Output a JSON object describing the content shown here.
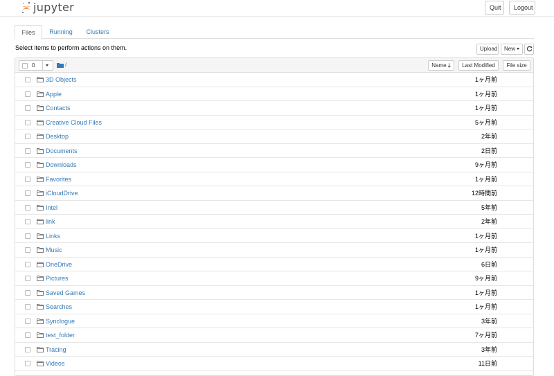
{
  "header": {
    "logo_text": "jupyter",
    "quit_label": "Quit",
    "logout_label": "Logout"
  },
  "tabs": [
    {
      "label": "Files",
      "active": true
    },
    {
      "label": "Running",
      "active": false
    },
    {
      "label": "Clusters",
      "active": false
    }
  ],
  "toolbar": {
    "instructions": "Select items to perform actions on them.",
    "upload_label": "Upload",
    "new_label": "New",
    "refresh_icon": "refresh-icon"
  },
  "list_header": {
    "selected_count": "0",
    "path": "/",
    "name_label": "Name",
    "last_modified_label": "Last Modified",
    "file_size_label": "File size"
  },
  "items": [
    {
      "name": "3D Objects",
      "modified": "1ヶ月前"
    },
    {
      "name": "Apple",
      "modified": "1ヶ月前"
    },
    {
      "name": "Contacts",
      "modified": "1ヶ月前"
    },
    {
      "name": "Creative Cloud Files",
      "modified": "5ヶ月前"
    },
    {
      "name": "Desktop",
      "modified": "2年前"
    },
    {
      "name": "Documents",
      "modified": "2日前"
    },
    {
      "name": "Downloads",
      "modified": "9ヶ月前"
    },
    {
      "name": "Favorites",
      "modified": "1ヶ月前"
    },
    {
      "name": "iCloudDrive",
      "modified": "12時間前"
    },
    {
      "name": "Intel",
      "modified": "5年前"
    },
    {
      "name": "link",
      "modified": "2年前"
    },
    {
      "name": "Links",
      "modified": "1ヶ月前"
    },
    {
      "name": "Music",
      "modified": "1ヶ月前"
    },
    {
      "name": "OneDrive",
      "modified": "6日前"
    },
    {
      "name": "Pictures",
      "modified": "9ヶ月前"
    },
    {
      "name": "Saved Games",
      "modified": "1ヶ月前"
    },
    {
      "name": "Searches",
      "modified": "1ヶ月前"
    },
    {
      "name": "Synclogue",
      "modified": "3年前"
    },
    {
      "name": "test_folder",
      "modified": "7ヶ月前"
    },
    {
      "name": "Tracing",
      "modified": "3年前"
    },
    {
      "name": "Videos",
      "modified": "11日前"
    }
  ],
  "colors": {
    "link": "#337ab7",
    "logo_orange": "#f37726",
    "header_bg": "#f5f5f5"
  }
}
